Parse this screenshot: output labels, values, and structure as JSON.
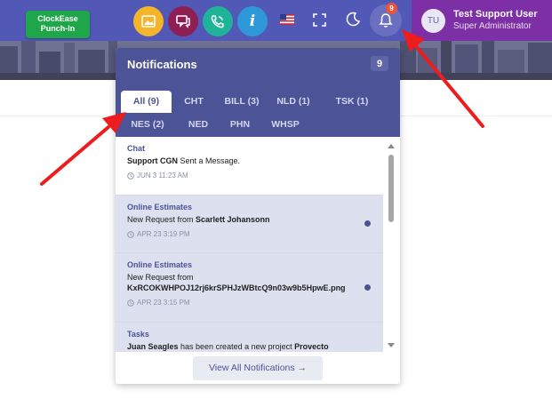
{
  "header": {
    "clock_button": {
      "line1": "ClockEase",
      "line2": "Punch-In"
    },
    "info_glyph": "i",
    "bell_badge": "9",
    "user": {
      "initials": "TU",
      "name": "Test Support User",
      "role": "Super Administrator"
    },
    "colors": {
      "header": "#5158b6",
      "user_area": "#7d2fa6",
      "clock_button": "#1fa64a",
      "gallery": "#f4b52a",
      "chat": "#8e1f55",
      "phone": "#1fb39a",
      "info": "#2e98d8"
    },
    "icons": [
      "gallery-icon",
      "chat-icon",
      "phone-icon",
      "info-icon",
      "us-flag-icon",
      "fullscreen-icon",
      "moon-icon",
      "bell-icon"
    ]
  },
  "notifications": {
    "title": "Notifications",
    "count": "9",
    "tabs": [
      {
        "label": "All (9)",
        "active": true
      },
      {
        "label": "CHT"
      },
      {
        "label": "BILL (3)"
      },
      {
        "label": "NLD (1)"
      },
      {
        "label": "TSK (1)"
      },
      {
        "label": "NES (2)"
      },
      {
        "label": "NED"
      },
      {
        "label": "PHN"
      },
      {
        "label": "WHSP"
      }
    ],
    "items": [
      {
        "category": "Chat",
        "bold_lead": "Support CGN",
        "text": " Sent a Message.",
        "time": "JUN 3 11:23 AM",
        "unread": false
      },
      {
        "category": "Online Estimates",
        "text": "New Request from ",
        "bold_tail": "Scarlett Johansonn",
        "time": "APR 23 3:19 PM",
        "unread": true
      },
      {
        "category": "Online Estimates",
        "text": "New Request from",
        "bold_line": "KxRCOKWHPOJ12rj6krSPHJzWBtcQ9n03w9b5HpwE.png",
        "time": "APR 23 3:15 PM",
        "unread": true
      },
      {
        "category": "Tasks",
        "bold_lead": "Juan Seagles",
        "text": " has been created a new project ",
        "bold_tail": "Provecto",
        "unread": true
      }
    ],
    "view_all": "View All Notifications →"
  }
}
